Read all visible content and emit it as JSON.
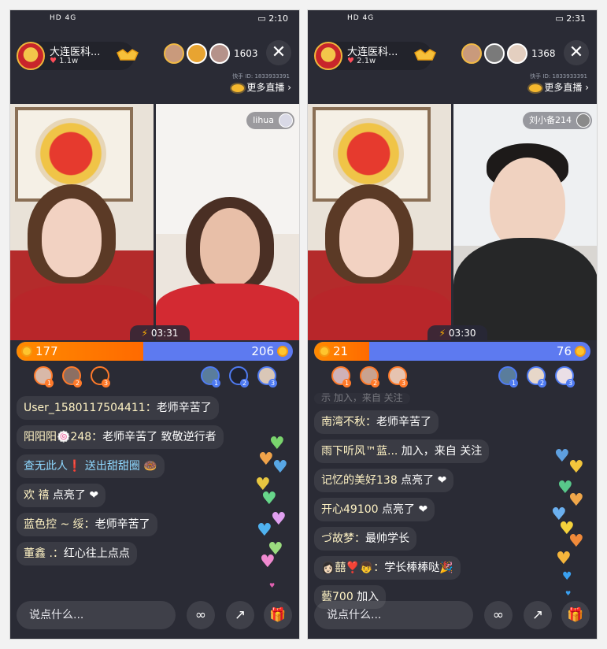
{
  "left": {
    "status": {
      "time": "2:10",
      "icons": "HD 4G"
    },
    "host": {
      "name": "大连医科...",
      "likes": "1.1w"
    },
    "viewer_count": "1603",
    "more_live": "更多直播",
    "id_line": "快手 ID: 1833933391",
    "partner_name": "lihua",
    "timer": "03:31",
    "pk": {
      "left_score": "177",
      "right_score": "206",
      "left_fraction": 0.46
    },
    "chat": [
      {
        "user": "User_1580117504411：",
        "text": "老师辛苦了"
      },
      {
        "user": "阳阳阳🍥248：",
        "text": "老师辛苦了 致敬逆行者"
      },
      {
        "user": "查无此人❗",
        "text": " 送出甜甜圈 🍩"
      },
      {
        "user": "欢 禧 ",
        "text": "点亮了 ❤"
      },
      {
        "user": "蓝色控 ~ 绥：",
        "text": "老师辛苦了"
      },
      {
        "user": "董鑫 .：",
        "text": "红心往上点点"
      }
    ],
    "input_placeholder": "说点什么..."
  },
  "right": {
    "status": {
      "time": "2:31",
      "icons": "HD 4G"
    },
    "host": {
      "name": "大连医科...",
      "likes": "2.1w"
    },
    "viewer_count": "1368",
    "more_live": "更多直播",
    "id_line": "快手 ID: 1833933391",
    "partner_name": "刘小备214",
    "timer": "03:30",
    "pk": {
      "left_score": "21",
      "right_score": "76",
      "left_fraction": 0.2
    },
    "chat_faded": "示 加入，来自 关注",
    "chat": [
      {
        "user": "南湾不秋：",
        "text": "老师辛苦了"
      },
      {
        "user": "雨下听风™蓝...",
        "text": " 加入，来自 关注"
      },
      {
        "user": "记忆的美好138 ",
        "text": "点亮了 ❤"
      },
      {
        "user": "开心49100 ",
        "text": "点亮了 ❤"
      },
      {
        "user": "づ故梦：",
        "text": "最帅学长"
      },
      {
        "user": "👩🏻囍❣️👦：",
        "text": "学长棒棒哒🎉"
      },
      {
        "user": "藝700 ",
        "text": "加入"
      }
    ],
    "input_placeholder": "说点什么..."
  },
  "icons": {
    "close": "close-icon",
    "link": "link-mic-icon",
    "share": "share-icon",
    "gift": "gift-icon"
  }
}
